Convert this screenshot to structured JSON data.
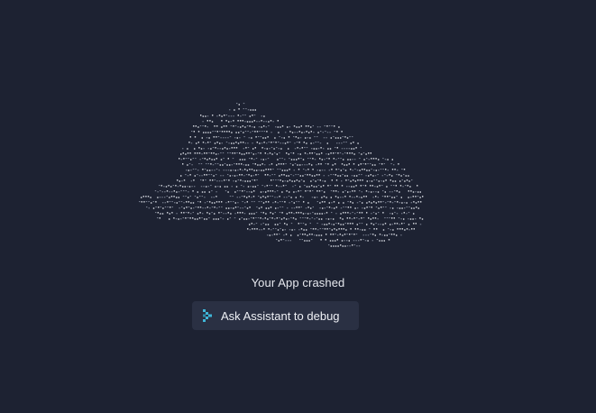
{
  "crash": {
    "title": "Your App crashed"
  },
  "assistant_button": {
    "label": "Ask Assistant to debug",
    "icon": "assistant-spark-icon"
  },
  "colors": {
    "background": "#1d2232",
    "button_bg": "#2a3043",
    "icon_accent": "#3fb6d8",
    "ascii_light": "#c9ccd4",
    "ascii_dim": "#7a8091"
  }
}
